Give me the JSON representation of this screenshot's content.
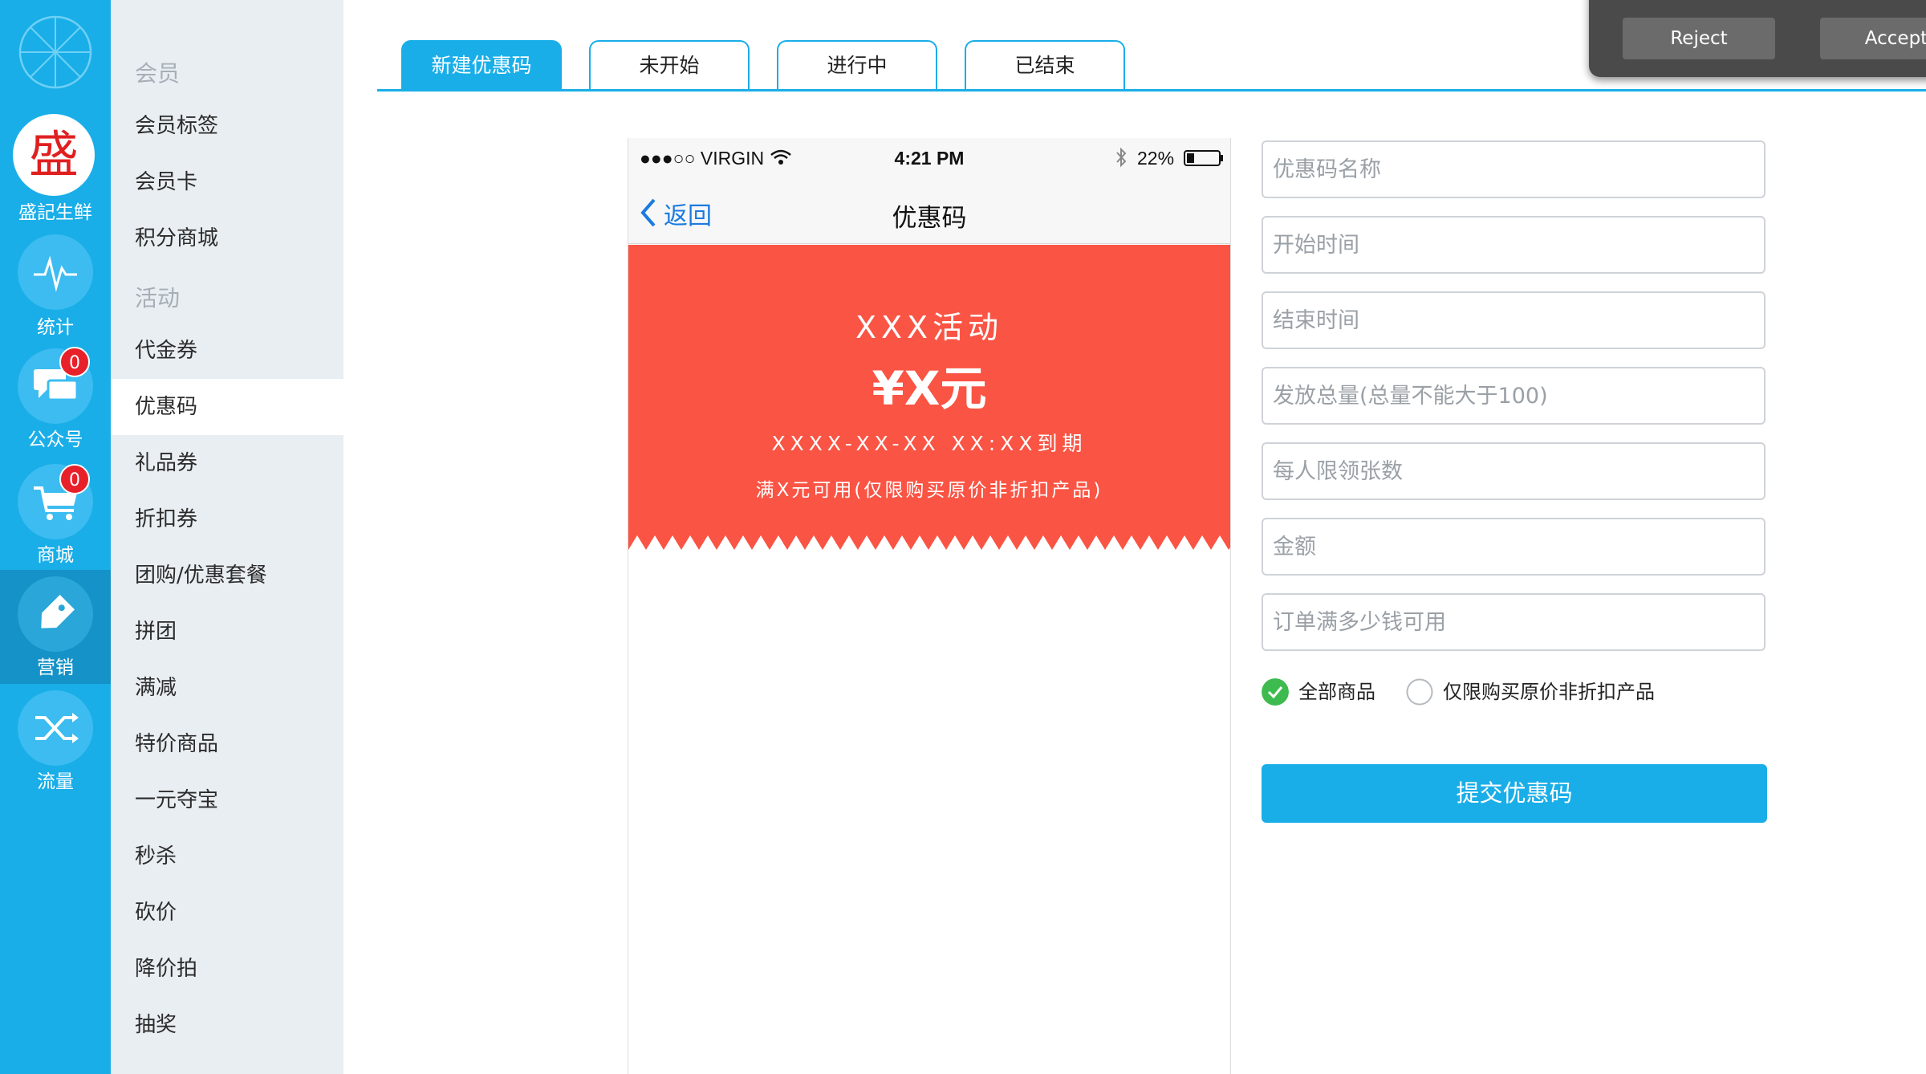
{
  "rail": {
    "brand_char": "盛",
    "brand_label": "盛記生鲜",
    "items": [
      {
        "label": "统计",
        "icon": "pulse-icon"
      },
      {
        "label": "公众号",
        "icon": "chat-bubbles-icon",
        "badge": "0"
      },
      {
        "label": "商城",
        "icon": "cart-icon",
        "badge": "0"
      },
      {
        "label": "营销",
        "icon": "tag-icon",
        "active": true
      },
      {
        "label": "流量",
        "icon": "shuffle-icon"
      }
    ]
  },
  "sidebar": {
    "group_member": "会员",
    "member_items": [
      "会员标签",
      "会员卡",
      "积分商城"
    ],
    "group_activity": "活动",
    "activity_items": [
      "代金券",
      "优惠码",
      "礼品券",
      "折扣券",
      "团购/优惠套餐",
      "拼团",
      "满减",
      "特价商品",
      "一元夺宝",
      "秒杀",
      "砍价",
      "降价拍",
      "抽奖"
    ],
    "active_item": "优惠码"
  },
  "tabs": [
    "新建优惠码",
    "未开始",
    "进行中",
    "已结束"
  ],
  "dialog": {
    "reject": "Reject",
    "accept": "Accept"
  },
  "phone": {
    "carrier": "●●●○○ VIRGIN",
    "time": "4:21 PM",
    "battery": "22%",
    "back": "返回",
    "title": "优惠码"
  },
  "coupon": {
    "activity": "XXX活动",
    "amount": "¥X元",
    "expiry": "XXXX-XX-XX XX:XX到期",
    "condition": "满X元可用(仅限购买原价非折扣产品)"
  },
  "form": {
    "fields": [
      {
        "placeholder": "优惠码名称"
      },
      {
        "placeholder": "开始时间"
      },
      {
        "placeholder": "结束时间"
      },
      {
        "placeholder": "发放总量(总量不能大于100)"
      },
      {
        "placeholder": "每人限领张数"
      },
      {
        "placeholder": "金额"
      },
      {
        "placeholder": "订单满多少钱可用"
      }
    ],
    "radio_all": "全部商品",
    "radio_limited": "仅限购买原价非折扣产品",
    "selected": "全部商品",
    "submit": "提交优惠码"
  },
  "colors": {
    "accent": "#19aee8",
    "coupon": "#fa5444",
    "badge": "#e8202a",
    "check": "#3dbb4e"
  }
}
